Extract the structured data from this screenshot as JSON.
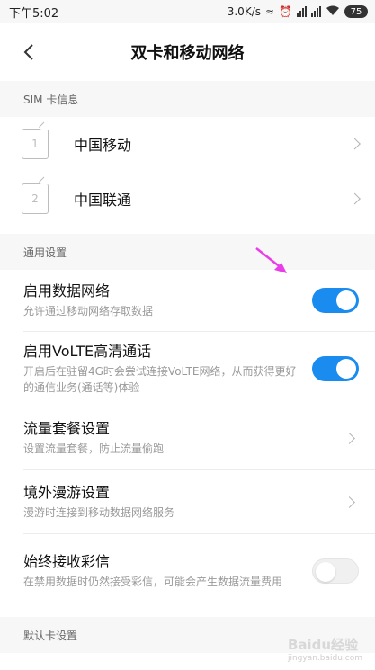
{
  "status_bar": {
    "time": "下午5:02",
    "speed": "3.0K/s",
    "battery": "75"
  },
  "nav": {
    "title": "双卡和移动网络"
  },
  "sim_section": {
    "header": "SIM 卡信息",
    "cards": [
      {
        "slot": "1",
        "name": "中国移动"
      },
      {
        "slot": "2",
        "name": "中国联通"
      }
    ]
  },
  "general_section": {
    "header": "通用设置",
    "items": [
      {
        "title": "启用数据网络",
        "subtitle": "允许通过移动网络存取数据",
        "toggle": true
      },
      {
        "title": "启用VoLTE高清通话",
        "subtitle": "开启后在驻留4G时会尝试连接VoLTE网络，从而获得更好的通信业务(通话等)体验",
        "toggle": true
      },
      {
        "title": "流量套餐设置",
        "subtitle": "设置流量套餐，防止流量偷跑"
      },
      {
        "title": "境外漫游设置",
        "subtitle": "漫游时连接到移动数据网络服务"
      },
      {
        "title": "始终接收彩信",
        "subtitle": "在禁用数据时仍然接受彩信，可能会产生数据流量费用",
        "toggle": false
      }
    ]
  },
  "default_section": {
    "header": "默认卡设置"
  },
  "watermark": {
    "brand": "Baidu经验",
    "url": "jingyan.baidu.com"
  },
  "colors": {
    "accent": "#1a8cf0",
    "annotation_arrow": "#e83ee8"
  }
}
